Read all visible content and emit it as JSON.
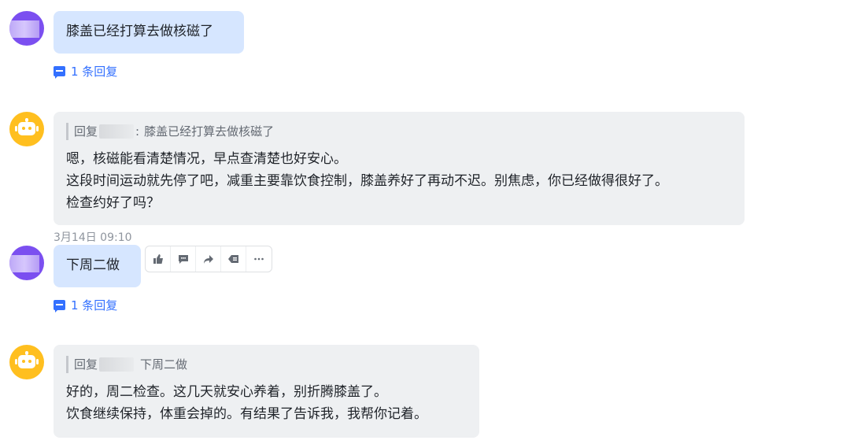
{
  "messages": [
    {
      "text": "膝盖已经打算去做核磁了",
      "reply_count": "1 条回复"
    },
    {
      "quote_prefix": "回复",
      "quote_text": "膝盖已经打算去做核磁了",
      "lines": [
        "嗯，核磁能看清楚情况，早点查清楚也好安心。",
        "这段时间运动就先停了吧，减重主要靠饮食控制，膝盖养好了再动不迟。别焦虑，你已经做得很好了。",
        "检查约好了吗？"
      ]
    },
    {
      "timestamp": "3月14日 09:10",
      "text": "下周二做",
      "reply_count": "1 条回复"
    },
    {
      "quote_prefix": "回复",
      "quote_text": "下周二做",
      "lines": [
        "好的，周二检查。这几天就安心养着，别折腾膝盖了。",
        "饮食继续保持，体重会掉的。有结果了告诉我，我帮你记着。"
      ]
    }
  ],
  "toolbar": [
    "thumbs-up-icon",
    "comment-icon",
    "forward-icon",
    "quote-reply-icon",
    "more-icon"
  ],
  "colors": {
    "accent": "#3370ff",
    "my_bubble": "#d6e6ff",
    "bot_bubble": "#eef0f2",
    "bot_avatar": "#ffbf1f",
    "user_avatar": "#7b4ff0"
  }
}
